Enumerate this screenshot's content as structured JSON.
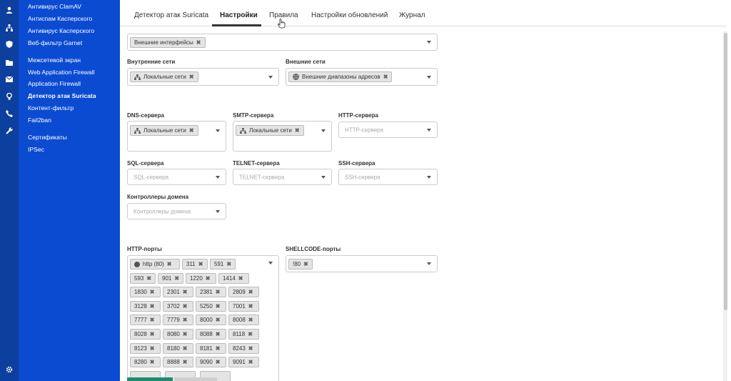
{
  "sidebar": {
    "items": [
      "Антивирус ClamAV",
      "Антиспам Касперского",
      "Антивирус Касперского",
      "Веб-фильтр Garnet",
      "Межсетевой экран",
      "Web Application Firewall",
      "Application Firewall",
      "Детектор атак Suricata",
      "Контент-фильтр",
      "Fail2ban",
      "Сертификаты",
      "IPSec"
    ],
    "active": "Детектор атак Suricata"
  },
  "tabs": [
    "Детектор атак Suricata",
    "Настройки",
    "Правила",
    "Настройки обновлений",
    "Журнал"
  ],
  "active_tab": "Настройки",
  "form": {
    "interfaces_chip": "Внешние интерфейсы",
    "internal_label": "Внутренние сети",
    "internal_chip": "Локальные сети",
    "external_label": "Внешние сети",
    "external_chip": "Внешние диапазоны адресов",
    "dns_label": "DNS-сервера",
    "dns_chip": "Локальные сети",
    "smtp_label": "SMTP-сервера",
    "smtp_chip": "Локальные сети",
    "http_label": "HTTP-сервера",
    "http_placeholder": "HTTP-сервера",
    "sql_label": "SQL-сервера",
    "sql_placeholder": "SQL-сервера",
    "telnet_label": "TELNET-сервера",
    "telnet_placeholder": "TELNET-сервера",
    "ssh_label": "SSH-сервера",
    "ssh_placeholder": "SSH-сервера",
    "dc_label": "Контроллеры домена",
    "dc_placeholder": "Контроллеры домена",
    "http_ports_label": "HTTP-порты",
    "http_ports": [
      "http (80)",
      "311",
      "591",
      "593",
      "901",
      "1220",
      "1414",
      "1830",
      "2301",
      "2381",
      "2809",
      "3128",
      "3702",
      "5250",
      "7001",
      "7777",
      "7779",
      "8000",
      "8008",
      "8028",
      "8080",
      "8088",
      "8118",
      "8123",
      "8180",
      "8181",
      "8243",
      "8280",
      "8888",
      "9090",
      "9091"
    ],
    "shellcode_label": "SHELLCODE-порты",
    "shellcode_chip": "!80"
  },
  "colors": {
    "sidebar": "#0b4bd1",
    "iconbar": "#0d3f9e",
    "accent": "#1f8a70"
  }
}
